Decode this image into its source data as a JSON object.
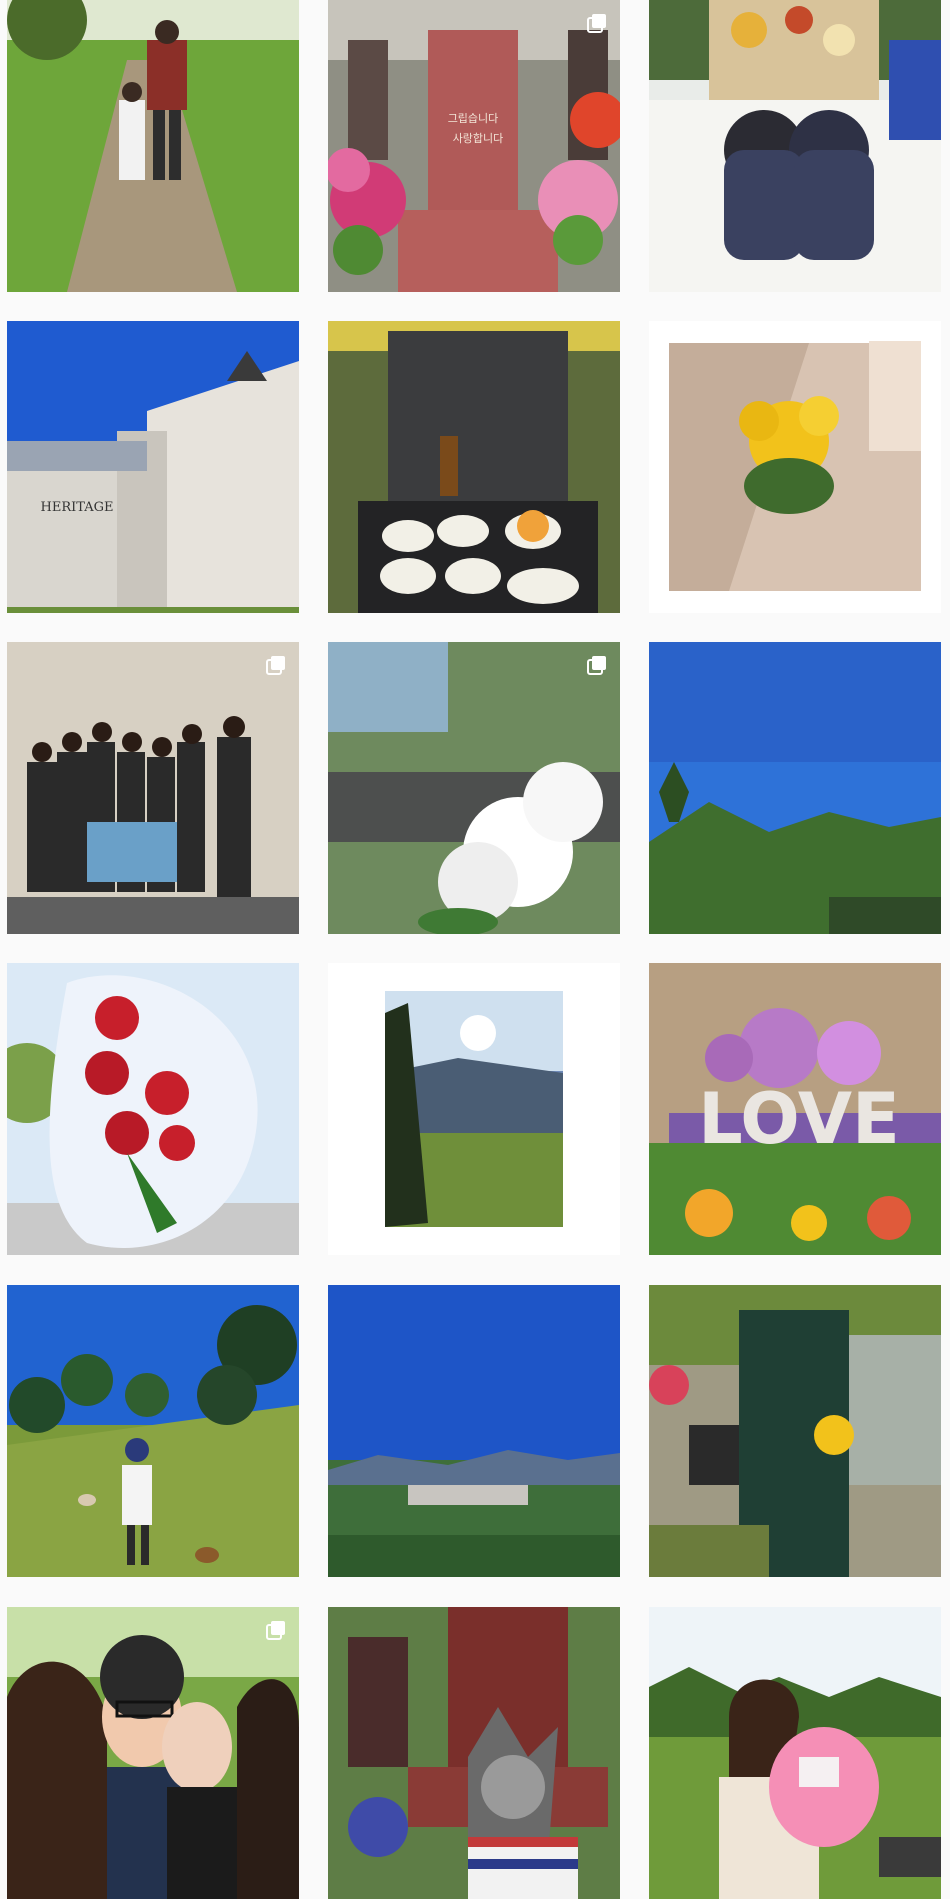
{
  "grid": {
    "posts": [
      {
        "subject": "child and man walking on grass path",
        "multiple": false
      },
      {
        "subject": "red granite memorial with flowers",
        "multiple": true,
        "inscription": [
          "그립습니다",
          "사랑합니다"
        ]
      },
      {
        "subject": "children at picnic food offering",
        "multiple": false
      },
      {
        "subject": "building wall with sculpture",
        "multiple": false,
        "sign": "HERITAGE"
      },
      {
        "subject": "black memorial stone with food offerings",
        "multiple": false
      },
      {
        "subject": "yellow flower pot on stone floor",
        "multiple": false
      },
      {
        "subject": "family group photo",
        "multiple": true
      },
      {
        "subject": "white chrysanthemums",
        "multiple": true
      },
      {
        "subject": "blue sky over hills",
        "multiple": false
      },
      {
        "subject": "red rose bouquet",
        "multiple": false
      },
      {
        "subject": "hill landscape print",
        "multiple": false
      },
      {
        "subject": "LOVE flower arrangement",
        "multiple": false,
        "text": "LOVE"
      },
      {
        "subject": "man with dogs on hillside",
        "multiple": false
      },
      {
        "subject": "wide city valley view",
        "multiple": false
      },
      {
        "subject": "green memorial marker with dates",
        "multiple": false
      },
      {
        "subject": "group selfie",
        "multiple": true
      },
      {
        "subject": "dog at memorial stone",
        "multiple": false
      },
      {
        "subject": "woman holding child",
        "multiple": false
      }
    ]
  },
  "icons": {
    "multi_post": "carousel-icon"
  },
  "colors": {
    "background": "#fafafa",
    "sky": "#2f6fd6",
    "grass": "#7aa83a"
  }
}
